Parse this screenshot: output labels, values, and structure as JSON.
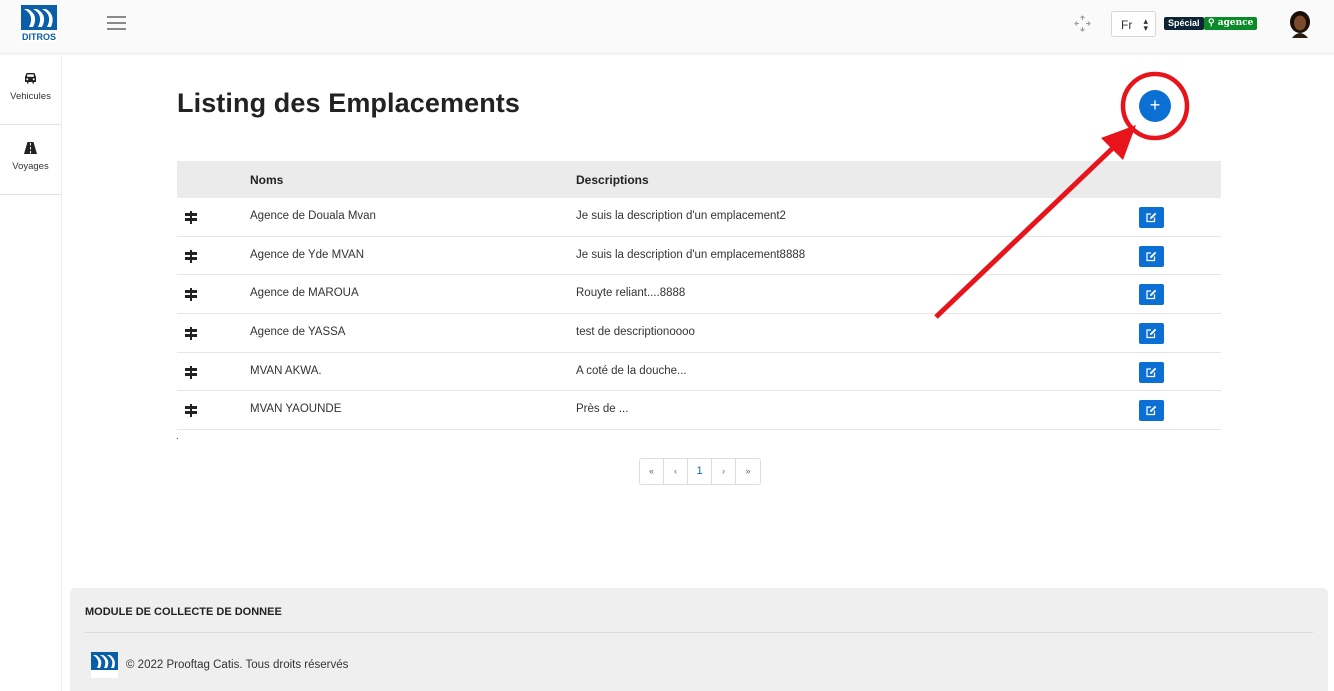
{
  "header": {
    "logo_text": "DITROS",
    "language": "Fr",
    "badge_special": "Spécial",
    "badge_agence": "agence"
  },
  "sidebar": {
    "items": [
      {
        "label": "Vehicules",
        "icon": "car-icon"
      },
      {
        "label": "Voyages",
        "icon": "road-icon"
      }
    ]
  },
  "main": {
    "title": "Listing des Emplacements",
    "add_button_label": "+",
    "table": {
      "columns": [
        "",
        "Noms",
        "Descriptions",
        ""
      ],
      "rows": [
        {
          "name": "Agence de Douala Mvan",
          "description": "Je suis la description d'un emplacement2"
        },
        {
          "name": "Agence de Yde MVAN",
          "description": "Je suis la description d'un emplacement8888"
        },
        {
          "name": "Agence de MAROUA",
          "description": "Rouyte reliant....8888"
        },
        {
          "name": "Agence de YASSA",
          "description": "test de descriptionoooo"
        },
        {
          "name": "MVAN AKWA.",
          "description": "A coté de la douche..."
        },
        {
          "name": "MVAN YAOUNDE",
          "description": "Près de ..."
        }
      ]
    },
    "dot": ".",
    "pagination": {
      "first": "«",
      "prev": "‹",
      "current": "1",
      "next": "›",
      "last": "»"
    }
  },
  "footer": {
    "title": "MODULE DE COLLECTE DE DONNEE",
    "copyright": "© 2022 Prooftag Catis. Tous droits réservés"
  },
  "colors": {
    "primary": "#0c6fd4",
    "annotation": "#e8141b",
    "badge_special": "#0d2435",
    "badge_agence": "#0a8a28"
  }
}
